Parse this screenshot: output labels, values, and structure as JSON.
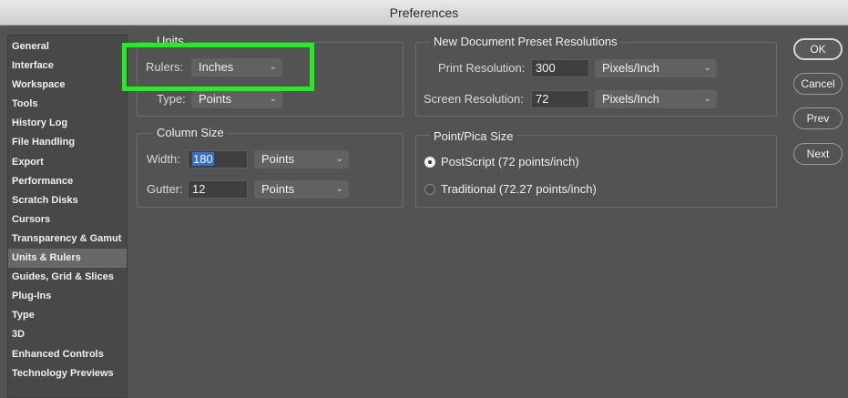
{
  "window": {
    "title": "Preferences"
  },
  "sidebar": {
    "items": [
      {
        "label": "General"
      },
      {
        "label": "Interface"
      },
      {
        "label": "Workspace"
      },
      {
        "label": "Tools"
      },
      {
        "label": "History Log"
      },
      {
        "label": "File Handling"
      },
      {
        "label": "Export"
      },
      {
        "label": "Performance"
      },
      {
        "label": "Scratch Disks"
      },
      {
        "label": "Cursors"
      },
      {
        "label": "Transparency & Gamut"
      },
      {
        "label": "Units & Rulers",
        "selected": true
      },
      {
        "label": "Guides, Grid & Slices"
      },
      {
        "label": "Plug-Ins"
      },
      {
        "label": "Type"
      },
      {
        "label": "3D"
      },
      {
        "label": "Enhanced Controls"
      },
      {
        "label": "Technology Previews"
      }
    ]
  },
  "units": {
    "title": "Units",
    "rulers_label": "Rulers:",
    "rulers_value": "Inches",
    "type_label": "Type:",
    "type_value": "Points"
  },
  "column_size": {
    "title": "Column Size",
    "width_label": "Width:",
    "width_value": "180",
    "width_unit": "Points",
    "gutter_label": "Gutter:",
    "gutter_value": "12",
    "gutter_unit": "Points"
  },
  "resolutions": {
    "title": "New Document Preset Resolutions",
    "print_label": "Print Resolution:",
    "print_value": "300",
    "print_unit": "Pixels/Inch",
    "screen_label": "Screen Resolution:",
    "screen_value": "72",
    "screen_unit": "Pixels/Inch"
  },
  "point_pica": {
    "title": "Point/Pica Size",
    "option_postscript": "PostScript (72 points/inch)",
    "option_traditional": "Traditional (72.27 points/inch)",
    "selected": "postscript"
  },
  "buttons": {
    "ok": "OK",
    "cancel": "Cancel",
    "prev": "Prev",
    "next": "Next"
  },
  "icons": {
    "dropdown": "chevron-down-icon",
    "radio": "radio-button-icon"
  },
  "colors": {
    "highlight": "#1ef01e",
    "selection": "#2f6fd6",
    "background": "#535353"
  }
}
